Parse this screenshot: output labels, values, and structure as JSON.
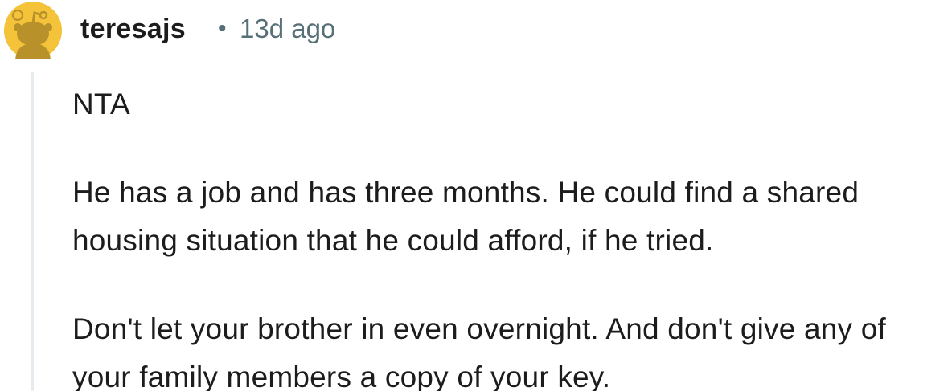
{
  "comment": {
    "author": "teresajs",
    "separator": "•",
    "timestamp": "13d ago",
    "avatar": {
      "icon": "snoo-avatar-icon",
      "color": "#f4c33a"
    },
    "paragraphs": [
      "NTA",
      "He has a job and has three months.  He could find a shared housing situation that he could afford, if he tried.",
      "Don't let your brother in even overnight.  And don't give any of your family members a copy of your key."
    ]
  }
}
